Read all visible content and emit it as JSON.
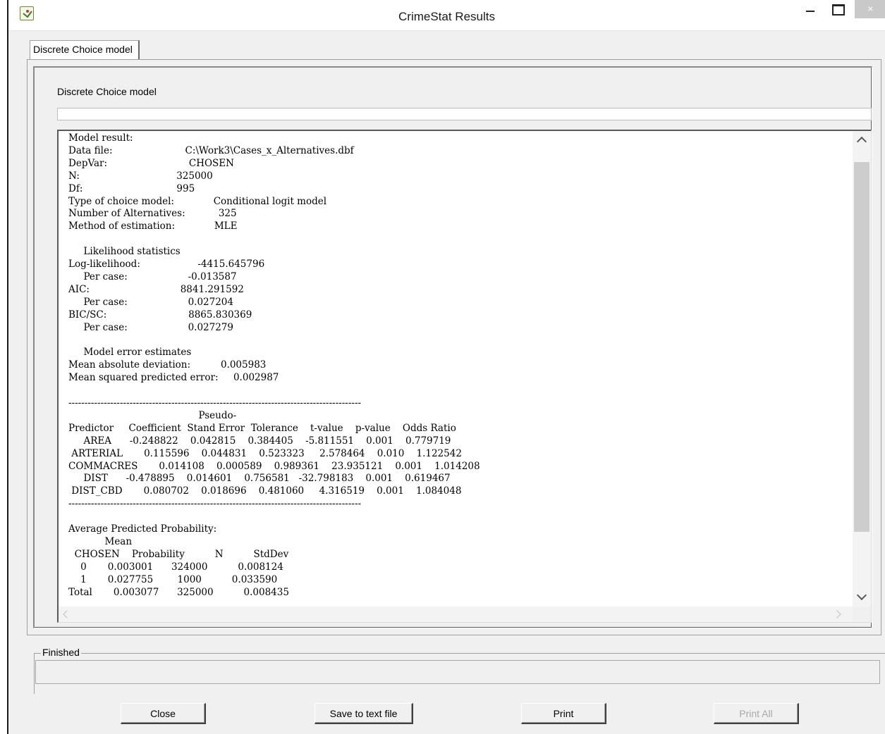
{
  "window": {
    "title": "CrimeStat Results",
    "close_glyph": "×"
  },
  "tab": {
    "label": "Discrete Choice model"
  },
  "group": {
    "title": "Discrete Choice model"
  },
  "results_text": [
    "Model result:",
    "Data file:                        C:\\Work3\\Cases_x_Alternatives.dbf",
    "DepVar:                           CHOSEN",
    "N:                                325000",
    "Df:                               995",
    "Type of choice model:             Conditional logit model",
    "Number of Alternatives:           325",
    "Method of estimation:             MLE",
    "",
    "     Likelihood statistics",
    "Log-likelihood:                   -4415.645796",
    "     Per case:                    -0.013587",
    "AIC:                              8841.291592",
    "     Per case:                    0.027204",
    "BIC/SC:                           8865.830369",
    "     Per case:                    0.027279",
    "",
    "     Model error estimates",
    "Mean absolute deviation:          0.005983",
    "Mean squared predicted error:     0.002987",
    "",
    "-------------------------------------------------------------------------------------------",
    "                                           Pseudo-",
    "Predictor     Coefficient  Stand Error  Tolerance    t-value    p-value    Odds Ratio",
    "     AREA      -0.248822    0.042815    0.384405    -5.811551    0.001    0.779719",
    " ARTERIAL       0.115596    0.044831    0.523323     2.578464    0.010    1.122542",
    "COMMACRES       0.014108    0.000589    0.989361    23.935121    0.001    1.014208",
    "     DIST      -0.478895    0.014601    0.756581   -32.798183    0.001    0.619467",
    " DIST_CBD       0.080702    0.018696    0.481060     4.316519    0.001    1.084048",
    "-------------------------------------------------------------------------------------------",
    "",
    "Average Predicted Probability:",
    "            Mean",
    "  CHOSEN    Probability          N          StdDev",
    "    0       0.003001      324000          0.008124",
    "    1       0.027755        1000          0.033590",
    "Total       0.003077      325000          0.008435"
  ],
  "status": {
    "label": "Finished",
    "value": ""
  },
  "buttons": {
    "close": "Close",
    "save": "Save to text file",
    "print": "Print",
    "print_all": "Print All"
  },
  "colors": {
    "window_bg": "#f0f0f0",
    "text_bg": "#ffffff",
    "disabled_text": "#a8a8a8"
  },
  "icons": {
    "app": "crimestat-app-icon",
    "minimize": "minimize-icon",
    "maximize": "maximize-icon",
    "close": "close-icon"
  }
}
